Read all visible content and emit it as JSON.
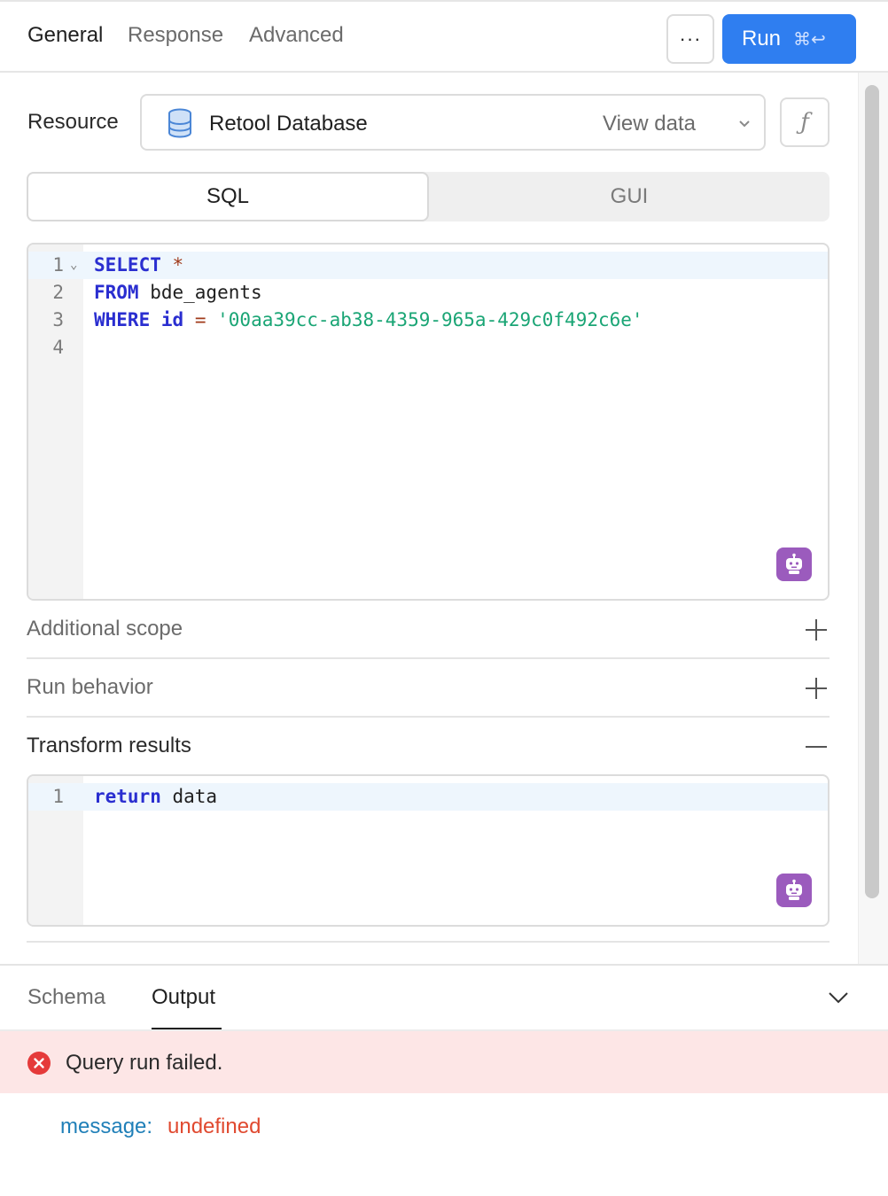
{
  "header": {
    "tabs": [
      {
        "label": "General",
        "active": true
      },
      {
        "label": "Response",
        "active": false
      },
      {
        "label": "Advanced",
        "active": false
      }
    ],
    "more_label": "···",
    "run_label": "Run",
    "run_shortcut": "⌘↩"
  },
  "resource": {
    "label": "Resource",
    "name": "Retool Database",
    "view_data_label": "View data",
    "fx_label": "ƒ"
  },
  "mode": {
    "sql_label": "SQL",
    "gui_label": "GUI",
    "selected": "SQL"
  },
  "sql_editor": {
    "lines": [
      {
        "number": "1",
        "tokens": [
          {
            "t": "SELECT",
            "c": "kw"
          },
          {
            "t": " ",
            "c": ""
          },
          {
            "t": "*",
            "c": "op"
          }
        ]
      },
      {
        "number": "2",
        "tokens": [
          {
            "t": "FROM",
            "c": "kw"
          },
          {
            "t": " bde_agents",
            "c": ""
          }
        ]
      },
      {
        "number": "3",
        "tokens": [
          {
            "t": "WHERE",
            "c": "kw"
          },
          {
            "t": " ",
            "c": ""
          },
          {
            "t": "id",
            "c": "kw"
          },
          {
            "t": " ",
            "c": ""
          },
          {
            "t": "=",
            "c": "op"
          },
          {
            "t": " ",
            "c": ""
          },
          {
            "t": "'00aa39cc-ab38-4359-965a-429c0f492c6e'",
            "c": "str"
          }
        ]
      },
      {
        "number": "4",
        "tokens": []
      }
    ]
  },
  "sections": {
    "additional_scope": "Additional scope",
    "run_behavior": "Run behavior",
    "transform_results": "Transform results"
  },
  "transform_editor": {
    "lines": [
      {
        "number": "1",
        "tokens": [
          {
            "t": "return",
            "c": "kw"
          },
          {
            "t": " data",
            "c": ""
          }
        ]
      }
    ]
  },
  "bottom_panel": {
    "tabs": [
      {
        "label": "Schema",
        "active": false
      },
      {
        "label": "Output",
        "active": true
      }
    ],
    "error_text": "Query run failed.",
    "message_key": "message:",
    "message_value": "undefined"
  },
  "colors": {
    "accent": "#2f7ef0",
    "keyword": "#2a2ed0",
    "string": "#1aa575",
    "error_bg": "#fde6e6",
    "error_icon": "#e53a3a",
    "ai_icon": "#9b5bbd"
  }
}
